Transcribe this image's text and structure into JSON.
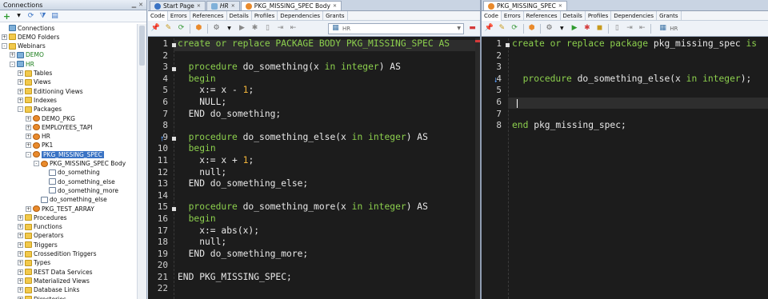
{
  "connections": {
    "title": "Connections",
    "tree": [
      {
        "label": "Connections",
        "icon": "connections-icon",
        "level": 0,
        "expander": ""
      },
      {
        "label": "DEMO Folders",
        "icon": "folder-icon",
        "level": 0,
        "expander": "+"
      },
      {
        "label": "Webinars",
        "icon": "folder-icon",
        "level": 0,
        "expander": "-"
      },
      {
        "label": "DEMO",
        "icon": "database-icon",
        "level": 1,
        "expander": "+",
        "style": "green"
      },
      {
        "label": "HR",
        "icon": "database-icon",
        "level": 1,
        "expander": "-",
        "style": "green"
      },
      {
        "label": "Tables",
        "icon": "folder-icon",
        "level": 2,
        "expander": "+"
      },
      {
        "label": "Views",
        "icon": "folder-icon",
        "level": 2,
        "expander": "+"
      },
      {
        "label": "Editioning Views",
        "icon": "folder-icon",
        "level": 2,
        "expander": "+"
      },
      {
        "label": "Indexes",
        "icon": "folder-icon",
        "level": 2,
        "expander": "+"
      },
      {
        "label": "Packages",
        "icon": "folder-icon",
        "level": 2,
        "expander": "-"
      },
      {
        "label": "DEMO_PKG",
        "icon": "package-icon",
        "level": 3,
        "expander": "+"
      },
      {
        "label": "EMPLOYEES_TAPI",
        "icon": "package-icon",
        "level": 3,
        "expander": "+"
      },
      {
        "label": "HR",
        "icon": "package-icon",
        "level": 3,
        "expander": "+"
      },
      {
        "label": "PK1",
        "icon": "package-icon",
        "level": 3,
        "expander": "+"
      },
      {
        "label": "PKG_MISSING_SPEC",
        "icon": "package-icon",
        "level": 3,
        "expander": "-",
        "style": "sel"
      },
      {
        "label": "PKG_MISSING_SPEC Body",
        "icon": "package-body-icon",
        "level": 4,
        "expander": "-"
      },
      {
        "label": "do_something",
        "icon": "procedure-icon",
        "level": 5,
        "expander": ""
      },
      {
        "label": "do_something_else",
        "icon": "procedure-icon",
        "level": 5,
        "expander": ""
      },
      {
        "label": "do_something_more",
        "icon": "procedure-icon",
        "level": 5,
        "expander": ""
      },
      {
        "label": "do_something_else",
        "icon": "procedure-icon",
        "level": 4,
        "expander": ""
      },
      {
        "label": "PKG_TEST_ARRAY",
        "icon": "package-icon",
        "level": 3,
        "expander": "+"
      },
      {
        "label": "Procedures",
        "icon": "folder-icon",
        "level": 2,
        "expander": "+"
      },
      {
        "label": "Functions",
        "icon": "folder-icon",
        "level": 2,
        "expander": "+"
      },
      {
        "label": "Operators",
        "icon": "folder-icon",
        "level": 2,
        "expander": "+"
      },
      {
        "label": "Triggers",
        "icon": "folder-icon",
        "level": 2,
        "expander": "+"
      },
      {
        "label": "Crossedition Triggers",
        "icon": "folder-icon",
        "level": 2,
        "expander": "+"
      },
      {
        "label": "Types",
        "icon": "folder-icon",
        "level": 2,
        "expander": "+"
      },
      {
        "label": "REST Data Services",
        "icon": "folder-icon",
        "level": 2,
        "expander": "+"
      },
      {
        "label": "Materialized Views",
        "icon": "folder-icon",
        "level": 2,
        "expander": "+"
      },
      {
        "label": "Database Links",
        "icon": "folder-icon",
        "level": 2,
        "expander": "+"
      },
      {
        "label": "Directories",
        "icon": "folder-icon",
        "level": 2,
        "expander": "+"
      }
    ]
  },
  "tabs_left": [
    {
      "label": "Start Page",
      "active": false
    },
    {
      "label": "HR",
      "active": false
    },
    {
      "label": "PKG_MISSING_SPEC Body",
      "active": true
    }
  ],
  "tabs_right": [
    {
      "label": "PKG_MISSING_SPEC",
      "active": true
    }
  ],
  "subtabs_left": [
    "Code",
    "Errors",
    "References",
    "Details",
    "Profiles",
    "Dependencies",
    "Grants"
  ],
  "subtabs_right": [
    "Code",
    "Errors",
    "References",
    "Details",
    "Profiles",
    "Dependencies",
    "Grants"
  ],
  "connection_select_left": "HR",
  "connection_select_right": "HR",
  "editor_left": {
    "lines": [
      [
        [
          "kw",
          "create or replace PACKAGE BODY PKG_MISSING_SPEC AS"
        ]
      ],
      [
        [
          "t",
          ""
        ]
      ],
      [
        [
          "t",
          "  "
        ],
        [
          "kw",
          "procedure"
        ],
        [
          "t",
          " do_something(x "
        ],
        [
          "kw",
          "in"
        ],
        [
          "t",
          " "
        ],
        [
          "kw",
          "integer"
        ],
        [
          "t",
          ") AS"
        ]
      ],
      [
        [
          "t",
          "  "
        ],
        [
          "kw",
          "begin"
        ]
      ],
      [
        [
          "t",
          "    x:= x - "
        ],
        [
          "num",
          "1"
        ],
        [
          "t",
          ";"
        ]
      ],
      [
        [
          "t",
          "    NULL;"
        ]
      ],
      [
        [
          "t",
          "  END do_something;"
        ]
      ],
      [
        [
          "t",
          ""
        ]
      ],
      [
        [
          "t",
          "  "
        ],
        [
          "kw",
          "procedure"
        ],
        [
          "t",
          " do_something_else(x "
        ],
        [
          "kw",
          "in"
        ],
        [
          "t",
          " "
        ],
        [
          "kw",
          "integer"
        ],
        [
          "t",
          ") AS"
        ]
      ],
      [
        [
          "t",
          "  "
        ],
        [
          "kw",
          "begin"
        ]
      ],
      [
        [
          "t",
          "    x:= x + "
        ],
        [
          "num",
          "1"
        ],
        [
          "t",
          ";"
        ]
      ],
      [
        [
          "t",
          "    null;"
        ]
      ],
      [
        [
          "t",
          "  END do_something_else;"
        ]
      ],
      [
        [
          "t",
          ""
        ]
      ],
      [
        [
          "t",
          "  "
        ],
        [
          "kw",
          "procedure"
        ],
        [
          "t",
          " do_something_more(x "
        ],
        [
          "kw",
          "in"
        ],
        [
          "t",
          " "
        ],
        [
          "kw",
          "integer"
        ],
        [
          "t",
          ") AS"
        ]
      ],
      [
        [
          "t",
          "  "
        ],
        [
          "kw",
          "begin"
        ]
      ],
      [
        [
          "t",
          "    x:= abs(x);"
        ]
      ],
      [
        [
          "t",
          "    null;"
        ]
      ],
      [
        [
          "t",
          "  END do_something_more;"
        ]
      ],
      [
        [
          "t",
          ""
        ]
      ],
      [
        [
          "t",
          "END PKG_MISSING_SPEC;"
        ]
      ],
      [
        [
          "t",
          ""
        ]
      ]
    ],
    "line_numbers": [
      "1",
      "2",
      "3",
      "4",
      "5",
      "6",
      "7",
      "8",
      "9",
      "10",
      "11",
      "12",
      "13",
      "14",
      "15",
      "16",
      "17",
      "18",
      "19",
      "20",
      "21",
      "22"
    ]
  },
  "editor_right": {
    "lines": [
      [
        [
          "kw",
          "create or replace package"
        ],
        [
          "t",
          " pkg_missing_spec "
        ],
        [
          "kw",
          "is"
        ]
      ],
      [
        [
          "t",
          ""
        ]
      ],
      [
        [
          "t",
          ""
        ]
      ],
      [
        [
          "t",
          "  "
        ],
        [
          "kw",
          "procedure"
        ],
        [
          "t",
          " do_something_else(x "
        ],
        [
          "kw",
          "in"
        ],
        [
          "t",
          " "
        ],
        [
          "kw",
          "integer"
        ],
        [
          "t",
          ");"
        ]
      ],
      [
        [
          "t",
          ""
        ]
      ],
      [
        [
          "t",
          ""
        ]
      ],
      [
        [
          "t",
          ""
        ]
      ],
      [
        [
          "kw",
          "end"
        ],
        [
          "t",
          " pkg_missing_spec;"
        ]
      ]
    ],
    "line_numbers": [
      "1",
      "2",
      "3",
      "4",
      "5",
      "6",
      "7",
      "8"
    ]
  },
  "colors": {
    "keyword": "#8ccf4d",
    "number": "#f2b43a",
    "editor_bg": "#1c1c1c",
    "selection": "#3a73c4"
  }
}
